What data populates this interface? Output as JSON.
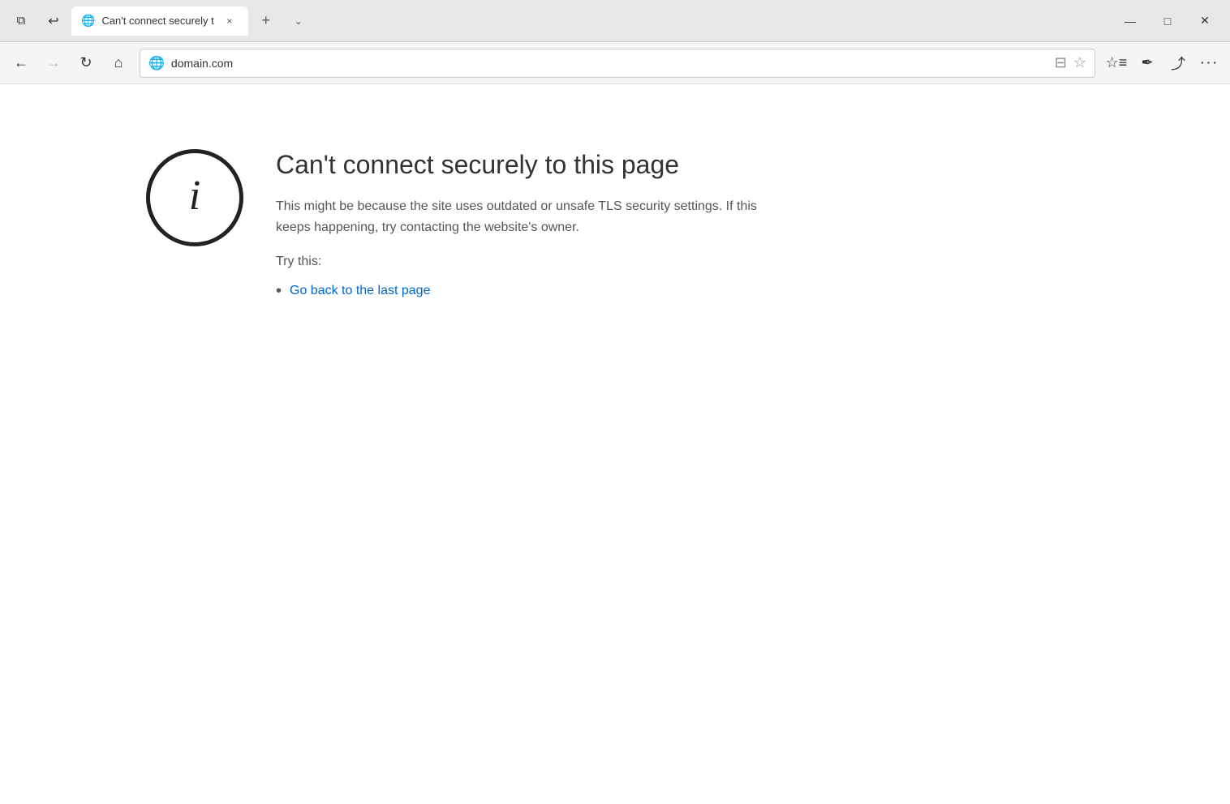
{
  "titlebar": {
    "tab_icon": "⬜",
    "tab_title": "Can't connect securely t",
    "tab_close_label": "×",
    "new_tab_label": "+",
    "tab_dropdown_label": "⌄",
    "btn_minimize": "—",
    "btn_restore": "□",
    "btn_close": "✕",
    "task_view": "⧉",
    "back_restore": "↩"
  },
  "navbar": {
    "back_label": "←",
    "forward_label": "→",
    "refresh_label": "↻",
    "home_label": "⌂",
    "address": "domain.com",
    "address_globe": "🌐",
    "reading_view_label": "⊟",
    "favorites_label": "☆",
    "toolbar_favorites_label": "★☆",
    "sign_label": "✒",
    "share_label": "⎋",
    "more_label": "···"
  },
  "page": {
    "error_title": "Can't connect securely to this page",
    "error_description": "This might be because the site uses outdated or unsafe TLS security settings. If this keeps happening, try contacting the website's owner.",
    "try_this_label": "Try this:",
    "suggestion_1": "Go back to the last page"
  }
}
